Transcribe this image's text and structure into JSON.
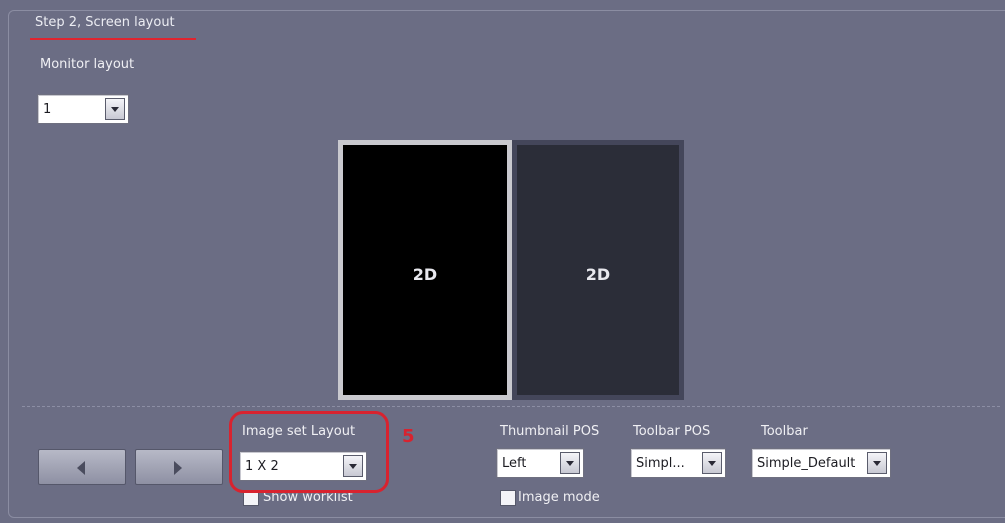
{
  "group": {
    "title": "Step 2, Screen layout"
  },
  "monitor_layout": {
    "label": "Monitor layout",
    "value": "1"
  },
  "preview": {
    "screens": [
      {
        "label": "2D"
      },
      {
        "label": "2D"
      }
    ]
  },
  "image_set_layout": {
    "label": "Image set Layout",
    "value": "1 X 2",
    "show_worklist_label": "Show worklist",
    "show_worklist_checked": false
  },
  "annotation": {
    "step_number": "5",
    "color": "#d8232f"
  },
  "thumbnail_pos": {
    "label": "Thumbnail POS",
    "value": "Left",
    "image_mode_label": "Image mode",
    "image_mode_checked": false
  },
  "toolbar_pos": {
    "label": "Toolbar POS",
    "value": "Simpl..."
  },
  "toolbar": {
    "label": "Toolbar",
    "value": "Simple_Default"
  },
  "nav": {
    "prev_icon": "arrow-left-icon",
    "next_icon": "arrow-right-icon"
  },
  "colors": {
    "background": "#6b6d84",
    "selected_screen": "#000000",
    "unselected_screen": "#2b2d38"
  }
}
